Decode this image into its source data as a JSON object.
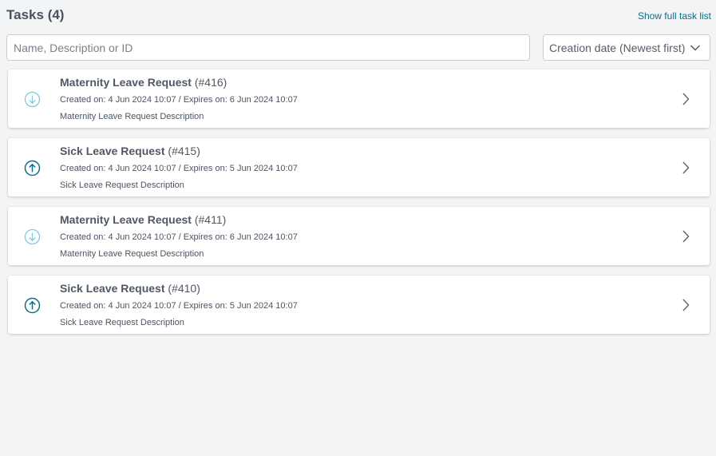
{
  "header": {
    "title": "Tasks",
    "count": "(4)",
    "show_full_link": "Show full task list"
  },
  "search": {
    "placeholder": "Name, Description or ID",
    "value": ""
  },
  "sort": {
    "selected": "Creation date (Newest first)",
    "icon": "chevron-down-icon"
  },
  "colors": {
    "incoming_icon": "#7ccbe0",
    "outgoing_icon": "#0f6d87",
    "link": "#0f6d87"
  },
  "tasks": [
    {
      "title": "Maternity Leave Request",
      "id": "(#416)",
      "dates": "Created on: 4 Jun 2024 10:07 / Expires on: 6 Jun 2024 10:07",
      "description": "Maternity Leave Request Description",
      "icon": "arrow-down-circle-icon"
    },
    {
      "title": "Sick Leave Request",
      "id": "(#415)",
      "dates": "Created on: 4 Jun 2024 10:07 / Expires on: 5 Jun 2024 10:07",
      "description": "Sick Leave Request Description",
      "icon": "arrow-up-circle-icon"
    },
    {
      "title": "Maternity Leave Request",
      "id": "(#411)",
      "dates": "Created on: 4 Jun 2024 10:07 / Expires on: 6 Jun 2024 10:07",
      "description": "Maternity Leave Request Description",
      "icon": "arrow-down-circle-icon"
    },
    {
      "title": "Sick Leave Request",
      "id": "(#410)",
      "dates": "Created on: 4 Jun 2024 10:07 / Expires on: 5 Jun 2024 10:07",
      "description": "Sick Leave Request Description",
      "icon": "arrow-up-circle-icon"
    }
  ]
}
